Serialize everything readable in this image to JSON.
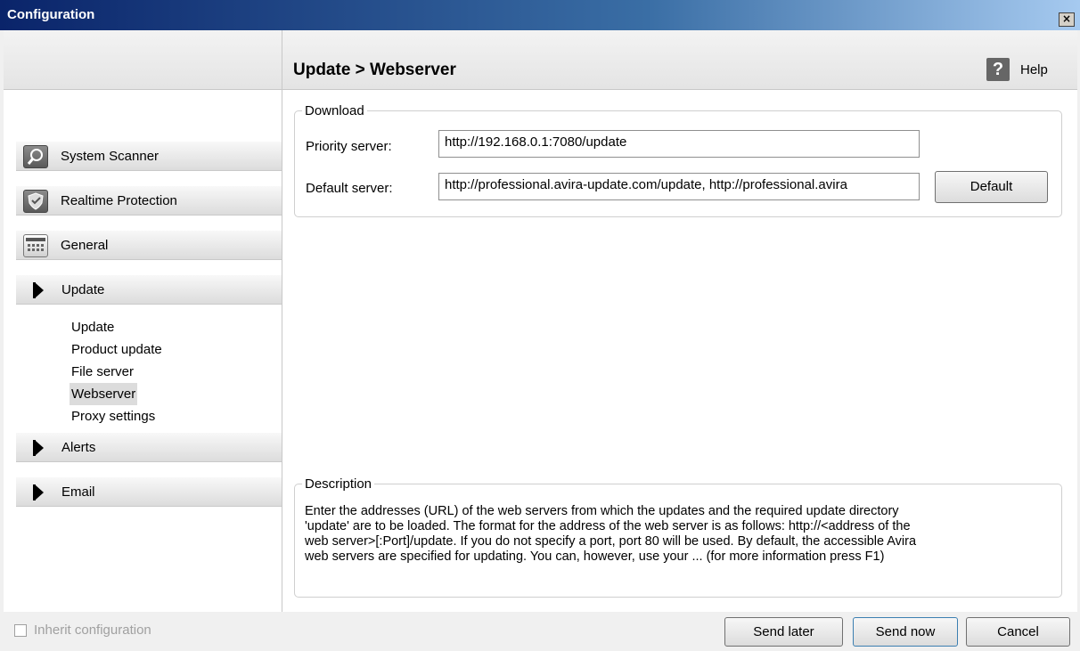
{
  "window": {
    "title": "Configuration",
    "close_glyph": "×"
  },
  "sidebar": {
    "sections": [
      {
        "label": "System Scanner",
        "icon": "magnifier-icon"
      },
      {
        "label": "Realtime Protection",
        "icon": "shield-icon"
      },
      {
        "label": "General",
        "icon": "calendar-icon"
      }
    ],
    "groups": [
      {
        "label": "Update",
        "expanded": true
      },
      {
        "label": "Alerts",
        "expanded": false
      },
      {
        "label": "Email",
        "expanded": false
      }
    ],
    "update_items": [
      "Update",
      "Product update",
      "File server",
      "Webserver",
      "Proxy settings"
    ],
    "selected_item": "Webserver"
  },
  "header": {
    "title": "Update > Webserver",
    "help_glyph": "?",
    "help_label": "Help"
  },
  "download": {
    "legend": "Download",
    "priority_label": "Priority server:",
    "priority_value": "http://192.168.0.1:7080/update",
    "default_label": "Default server:",
    "default_value": "http://professional.avira-update.com/update, http://professional.avira",
    "default_button": "Default"
  },
  "description": {
    "legend": "Description",
    "lines": [
      "Enter the addresses (URL) of the web servers from which the updates and the required update directory",
      "'update' are to be loaded. The format for the address of the web server is as follows: http://<address of the",
      "web server>[:Port]/update. If you do not specify a port, port 80 will be used. By default, the accessible Avira",
      "web servers are specified for updating. You can, however, use your  ...  (for more information press F1)"
    ]
  },
  "footer": {
    "inherit_label": "Inherit configuration",
    "inherit_checked": false,
    "send_later": "Send later",
    "send_now": "Send now",
    "cancel": "Cancel"
  }
}
